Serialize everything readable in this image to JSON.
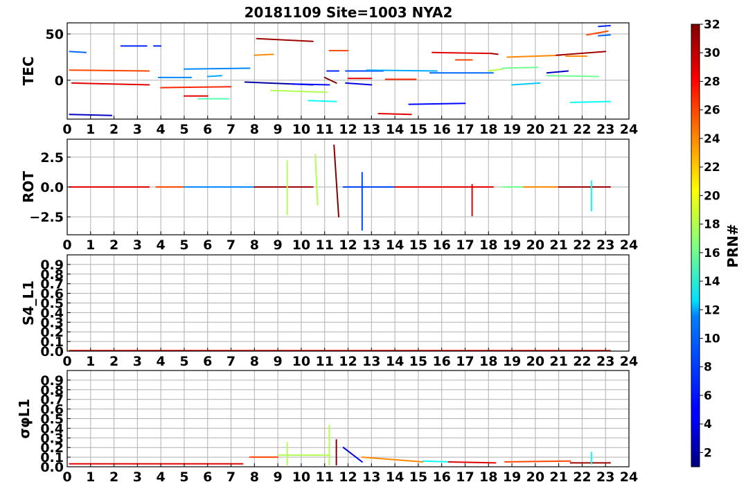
{
  "title": "20181109 Site=1003 NYA2",
  "colorbar": {
    "label": "PRN#",
    "min": 1,
    "max": 32,
    "ticks": [
      2,
      4,
      6,
      8,
      10,
      12,
      14,
      16,
      18,
      20,
      22,
      24,
      26,
      28,
      30,
      32
    ],
    "colormap": "jet"
  },
  "chart_data": [
    {
      "type": "line",
      "ylabel": "TEC",
      "xlim": [
        0,
        24
      ],
      "ylim": [
        -42,
        62
      ],
      "xticks": [
        0,
        1,
        2,
        3,
        4,
        5,
        6,
        7,
        8,
        9,
        10,
        11,
        12,
        13,
        14,
        15,
        16,
        17,
        18,
        19,
        20,
        21,
        22,
        23,
        24
      ],
      "yticks": [
        0,
        50
      ],
      "grid": true,
      "series": [
        {
          "prn": 3,
          "x": [
            0.1,
            1.9
          ],
          "y": [
            -37,
            -38
          ]
        },
        {
          "prn": 29,
          "x": [
            0.2,
            3.5
          ],
          "y": [
            -3,
            -5
          ]
        },
        {
          "prn": 26,
          "x": [
            0.1,
            3.5
          ],
          "y": [
            11,
            10
          ]
        },
        {
          "prn": 8,
          "x": [
            0.1,
            0.8
          ],
          "y": [
            31,
            30
          ]
        },
        {
          "prn": 6,
          "x": [
            2.3,
            3.4
          ],
          "y": [
            37,
            37
          ]
        },
        {
          "prn": 6,
          "x": [
            3.7,
            4.0
          ],
          "y": [
            37,
            37
          ]
        },
        {
          "prn": 9,
          "x": [
            3.9,
            5.3
          ],
          "y": [
            3,
            3
          ]
        },
        {
          "prn": 27,
          "x": [
            4.0,
            7.0
          ],
          "y": [
            -8,
            -7
          ]
        },
        {
          "prn": 9,
          "x": [
            5.0,
            7.8
          ],
          "y": [
            12,
            13
          ]
        },
        {
          "prn": 29,
          "x": [
            5.0,
            6.0
          ],
          "y": [
            -17,
            -17
          ]
        },
        {
          "prn": 15,
          "x": [
            5.6,
            6.9
          ],
          "y": [
            -20,
            -20
          ]
        },
        {
          "prn": 10,
          "x": [
            6.0,
            6.6
          ],
          "y": [
            4,
            5
          ]
        },
        {
          "prn": 2,
          "x": [
            7.6,
            10.5
          ],
          "y": [
            -2,
            -5
          ]
        },
        {
          "prn": 31,
          "x": [
            8.1,
            10.5
          ],
          "y": [
            45,
            42
          ]
        },
        {
          "prn": 24,
          "x": [
            8.0,
            8.8
          ],
          "y": [
            27,
            28
          ]
        },
        {
          "prn": 18,
          "x": [
            8.7,
            11.1
          ],
          "y": [
            -11,
            -13
          ]
        },
        {
          "prn": 5,
          "x": [
            9.6,
            11.2
          ],
          "y": [
            -4,
            -5
          ]
        },
        {
          "prn": 13,
          "x": [
            10.3,
            11.5
          ],
          "y": [
            -22,
            -23
          ]
        },
        {
          "prn": 32,
          "x": [
            11.0,
            11.5
          ],
          "y": [
            3,
            -3
          ]
        },
        {
          "prn": 6,
          "x": [
            11.1,
            11.6
          ],
          "y": [
            10,
            10
          ]
        },
        {
          "prn": 26,
          "x": [
            11.2,
            12.0
          ],
          "y": [
            32,
            32
          ]
        },
        {
          "prn": 4,
          "x": [
            11.9,
            13.0
          ],
          "y": [
            -3,
            -5
          ]
        },
        {
          "prn": 29,
          "x": [
            12.0,
            13.0
          ],
          "y": [
            2,
            2
          ]
        },
        {
          "prn": 7,
          "x": [
            11.9,
            13.5
          ],
          "y": [
            10,
            10
          ]
        },
        {
          "prn": 10,
          "x": [
            12.8,
            15.8
          ],
          "y": [
            11,
            10
          ]
        },
        {
          "prn": 29,
          "x": [
            13.3,
            14.7
          ],
          "y": [
            -36,
            -37
          ]
        },
        {
          "prn": 27,
          "x": [
            13.6,
            14.9
          ],
          "y": [
            1,
            1
          ]
        },
        {
          "prn": 5,
          "x": [
            14.6,
            17.0
          ],
          "y": [
            -26,
            -25
          ]
        },
        {
          "prn": 8,
          "x": [
            15.5,
            18.2
          ],
          "y": [
            8,
            8
          ]
        },
        {
          "prn": 29,
          "x": [
            15.6,
            18.1
          ],
          "y": [
            30,
            29
          ]
        },
        {
          "prn": 31,
          "x": [
            18.1,
            18.4
          ],
          "y": [
            29,
            28
          ]
        },
        {
          "prn": 26,
          "x": [
            16.6,
            17.3
          ],
          "y": [
            22,
            22
          ]
        },
        {
          "prn": 18,
          "x": [
            18.0,
            18.6
          ],
          "y": [
            10,
            12
          ]
        },
        {
          "prn": 16,
          "x": [
            18.6,
            20.1
          ],
          "y": [
            13,
            14
          ]
        },
        {
          "prn": 24,
          "x": [
            18.8,
            21.1
          ],
          "y": [
            25,
            27
          ]
        },
        {
          "prn": 11,
          "x": [
            19.0,
            20.2
          ],
          "y": [
            -5,
            -3
          ]
        },
        {
          "prn": 3,
          "x": [
            20.5,
            21.4
          ],
          "y": [
            8,
            10
          ]
        },
        {
          "prn": 16,
          "x": [
            20.5,
            22.7
          ],
          "y": [
            5,
            4
          ]
        },
        {
          "prn": 31,
          "x": [
            20.9,
            23.0
          ],
          "y": [
            27,
            31
          ]
        },
        {
          "prn": 24,
          "x": [
            21.3,
            22.2
          ],
          "y": [
            26,
            26
          ]
        },
        {
          "prn": 13,
          "x": [
            21.5,
            23.2
          ],
          "y": [
            -24,
            -23
          ]
        },
        {
          "prn": 26,
          "x": [
            22.2,
            23.1
          ],
          "y": [
            49,
            53
          ]
        },
        {
          "prn": 6,
          "x": [
            22.7,
            23.2
          ],
          "y": [
            58,
            59
          ]
        },
        {
          "prn": 8,
          "x": [
            22.7,
            23.2
          ],
          "y": [
            48,
            49
          ]
        }
      ]
    },
    {
      "type": "line",
      "ylabel": "ROT",
      "xlim": [
        0,
        24
      ],
      "ylim": [
        -4,
        4
      ],
      "xticks": [
        0,
        1,
        2,
        3,
        4,
        5,
        6,
        7,
        8,
        9,
        10,
        11,
        12,
        13,
        14,
        15,
        16,
        17,
        18,
        19,
        20,
        21,
        22,
        23,
        24
      ],
      "yticks": [
        -2.5,
        0.0,
        2.5
      ],
      "yticklabels": [
        "−2.5",
        "0.0",
        "2.5"
      ],
      "grid": true,
      "series": [
        {
          "prn": 29,
          "x": [
            0.1,
            3.5
          ],
          "y": [
            0,
            0
          ]
        },
        {
          "prn": 26,
          "x": [
            3.8,
            5.0
          ],
          "y": [
            0,
            0
          ]
        },
        {
          "prn": 9,
          "x": [
            5.0,
            8.0
          ],
          "y": [
            0,
            0
          ]
        },
        {
          "prn": 31,
          "x": [
            8.0,
            10.5
          ],
          "y": [
            0,
            0
          ]
        },
        {
          "prn": 18,
          "x": [
            9.4,
            9.4
          ],
          "y": [
            2.2,
            -2.3
          ]
        },
        {
          "prn": 18,
          "x": [
            10.6,
            10.7
          ],
          "y": [
            2.7,
            -1.5
          ]
        },
        {
          "prn": 32,
          "x": [
            11.4,
            11.6
          ],
          "y": [
            3.5,
            -2.5
          ]
        },
        {
          "prn": 7,
          "x": [
            11.8,
            14.0
          ],
          "y": [
            0,
            0
          ]
        },
        {
          "prn": 7,
          "x": [
            12.6,
            12.6
          ],
          "y": [
            1.2,
            -3.6
          ]
        },
        {
          "prn": 29,
          "x": [
            14.0,
            18.2
          ],
          "y": [
            0,
            0
          ]
        },
        {
          "prn": 29,
          "x": [
            17.3,
            17.3
          ],
          "y": [
            0.2,
            -2.4
          ]
        },
        {
          "prn": 16,
          "x": [
            18.6,
            20.0
          ],
          "y": [
            0,
            0
          ]
        },
        {
          "prn": 24,
          "x": [
            19.5,
            21.5
          ],
          "y": [
            0,
            0
          ]
        },
        {
          "prn": 31,
          "x": [
            21.0,
            23.2
          ],
          "y": [
            0,
            0
          ]
        },
        {
          "prn": 13,
          "x": [
            22.4,
            22.4
          ],
          "y": [
            0.5,
            -2.0
          ]
        }
      ]
    },
    {
      "type": "line",
      "ylabel": "S4_L1",
      "xlim": [
        0,
        24
      ],
      "ylim": [
        0,
        1
      ],
      "xticks": [
        0,
        1,
        2,
        3,
        4,
        5,
        6,
        7,
        8,
        9,
        10,
        11,
        12,
        13,
        14,
        15,
        16,
        17,
        18,
        19,
        20,
        21,
        22,
        23,
        24
      ],
      "yticks": [
        0.0,
        0.1,
        0.2,
        0.3,
        0.4,
        0.5,
        0.6,
        0.7,
        0.8,
        0.9
      ],
      "yticklabels": [
        "0.0",
        "0.1",
        "0.2",
        "0.3",
        "0.4",
        "0.5",
        "0.6",
        "0.7",
        "0.8",
        "0.9"
      ],
      "grid": true,
      "series": [
        {
          "prn": 29,
          "x": [
            0.1,
            23.2
          ],
          "y": [
            0.005,
            0.005
          ]
        }
      ]
    },
    {
      "type": "line",
      "ylabel": "σφL1",
      "xlim": [
        0,
        24
      ],
      "ylim": [
        0,
        1
      ],
      "xticks": [
        0,
        1,
        2,
        3,
        4,
        5,
        6,
        7,
        8,
        9,
        10,
        11,
        12,
        13,
        14,
        15,
        16,
        17,
        18,
        19,
        20,
        21,
        22,
        23,
        24
      ],
      "yticks": [
        0.0,
        0.1,
        0.2,
        0.3,
        0.4,
        0.5,
        0.6,
        0.7,
        0.8,
        0.9
      ],
      "yticklabels": [
        "0.0",
        "0.1",
        "0.2",
        "0.3",
        "0.4",
        "0.5",
        "0.6",
        "0.7",
        "0.8",
        "0.9"
      ],
      "grid": true,
      "series": [
        {
          "prn": 29,
          "x": [
            0.1,
            7.5
          ],
          "y": [
            0.03,
            0.03
          ]
        },
        {
          "prn": 26,
          "x": [
            7.8,
            9.0
          ],
          "y": [
            0.1,
            0.1
          ]
        },
        {
          "prn": 18,
          "x": [
            9.0,
            11.2
          ],
          "y": [
            0.12,
            0.12
          ]
        },
        {
          "prn": 18,
          "x": [
            9.4,
            9.4
          ],
          "y": [
            0.25,
            0.02
          ]
        },
        {
          "prn": 18,
          "x": [
            11.2,
            11.2
          ],
          "y": [
            0.43,
            0.02
          ]
        },
        {
          "prn": 32,
          "x": [
            11.5,
            11.5
          ],
          "y": [
            0.28,
            0.02
          ]
        },
        {
          "prn": 4,
          "x": [
            11.8,
            12.6
          ],
          "y": [
            0.2,
            0.05
          ]
        },
        {
          "prn": 24,
          "x": [
            12.6,
            15.2
          ],
          "y": [
            0.1,
            0.05
          ]
        },
        {
          "prn": 13,
          "x": [
            15.2,
            16.3
          ],
          "y": [
            0.06,
            0.05
          ]
        },
        {
          "prn": 29,
          "x": [
            16.3,
            18.3
          ],
          "y": [
            0.05,
            0.04
          ]
        },
        {
          "prn": 26,
          "x": [
            18.7,
            21.5
          ],
          "y": [
            0.05,
            0.06
          ]
        },
        {
          "prn": 31,
          "x": [
            21.5,
            23.2
          ],
          "y": [
            0.04,
            0.04
          ]
        },
        {
          "prn": 13,
          "x": [
            22.4,
            22.4
          ],
          "y": [
            0.15,
            0.03
          ]
        }
      ]
    }
  ]
}
